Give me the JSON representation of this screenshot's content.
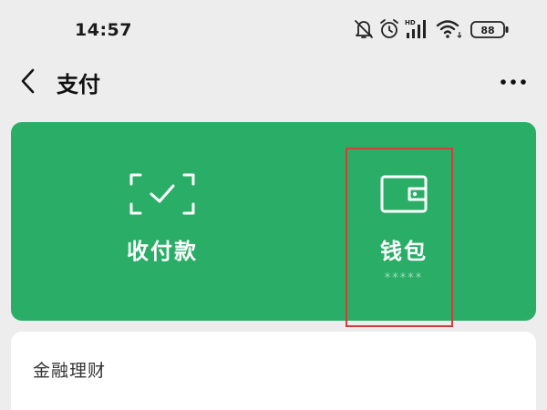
{
  "status_bar": {
    "time": "14:57",
    "network_label": "HD",
    "battery": "88",
    "icons": [
      "mute-bell-icon",
      "alarm-icon",
      "signal-icon",
      "wifi-icon",
      "battery-icon"
    ]
  },
  "nav": {
    "title": "支付",
    "back_icon": "chevron-left-icon",
    "more_icon": "more-dots-icon"
  },
  "services": {
    "color": "#2aae67",
    "items": [
      {
        "label": "收付款",
        "icon": "scan-check-icon"
      },
      {
        "label": "钱包",
        "icon": "wallet-icon",
        "sub": "*****"
      }
    ]
  },
  "finance": {
    "title": "金融理财"
  },
  "annotation": {
    "highlight_color": "#d93a3a"
  }
}
